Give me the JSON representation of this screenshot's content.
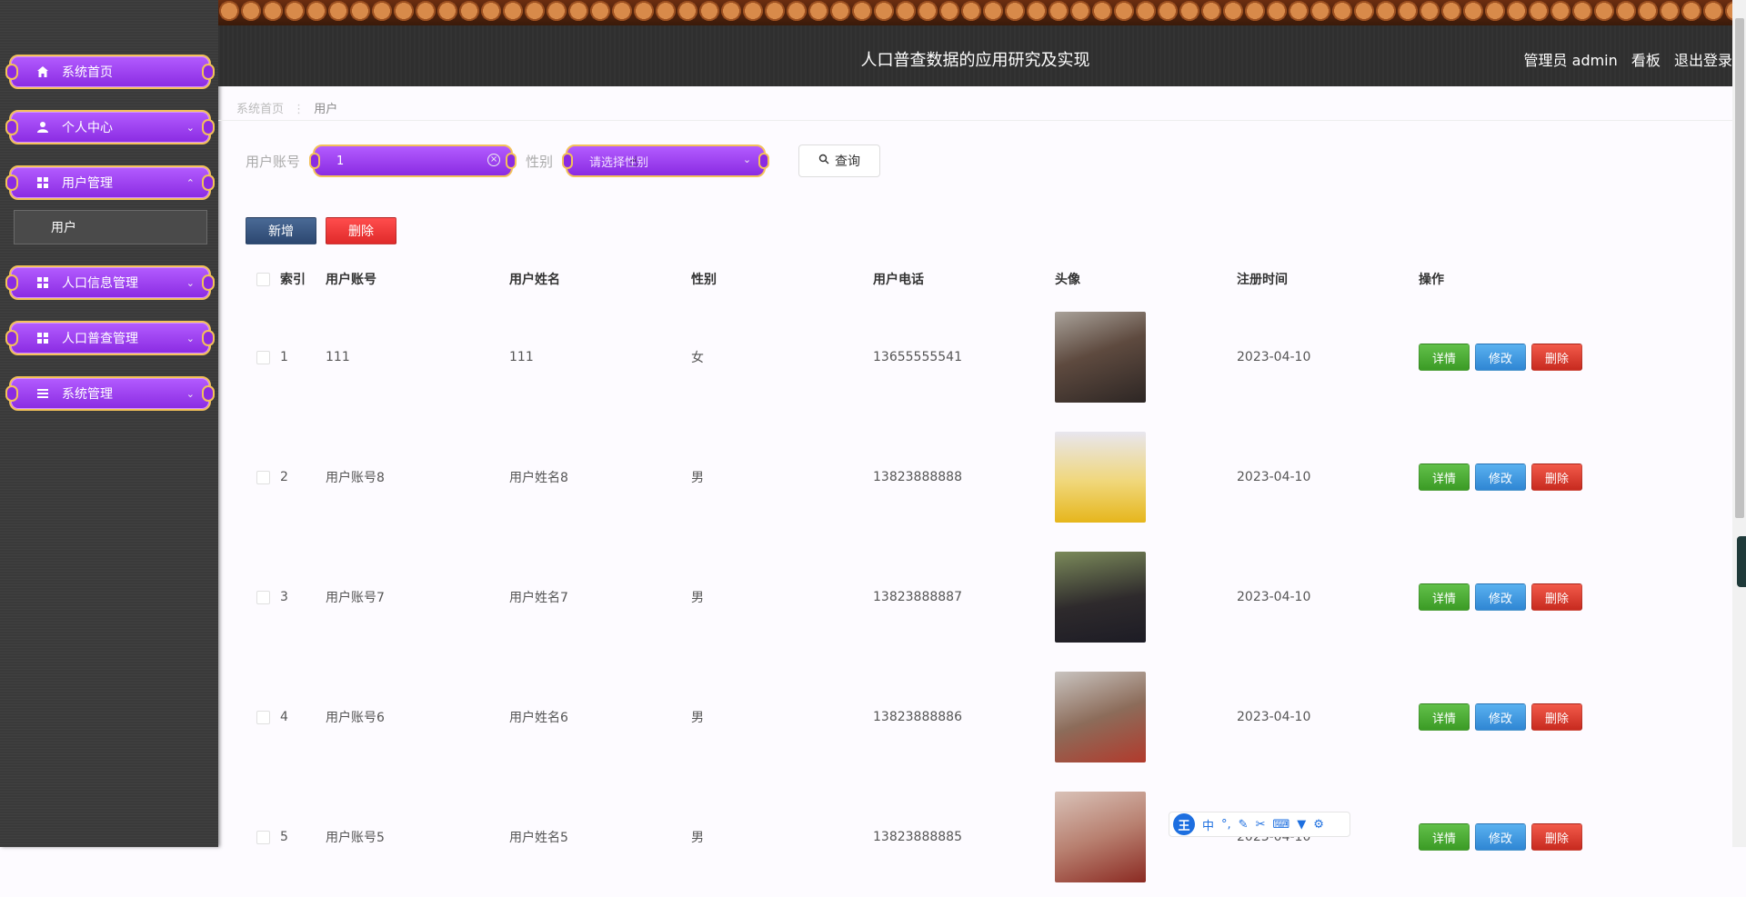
{
  "header": {
    "title": "人口普查数据的应用研究及实现",
    "role_label": "管理员 admin",
    "dashboard_label": "看板",
    "logout_label": "退出登录"
  },
  "sidebar": {
    "items": [
      {
        "label": "系统首页",
        "icon": "home-icon"
      },
      {
        "label": "个人中心",
        "icon": "user-icon"
      },
      {
        "label": "用户管理",
        "icon": "grid-icon"
      },
      {
        "label": "人口信息管理",
        "icon": "grid-icon"
      },
      {
        "label": "人口普查管理",
        "icon": "grid-icon"
      },
      {
        "label": "系统管理",
        "icon": "list-icon"
      }
    ],
    "submenu_active": "用户"
  },
  "breadcrumb": {
    "home": "系统首页",
    "current": "用户"
  },
  "search": {
    "account_label": "用户账号",
    "account_value": "1",
    "gender_label": "性别",
    "gender_placeholder": "请选择性别",
    "search_button": "查询"
  },
  "actions": {
    "add_label": "新增",
    "delete_label": "删除"
  },
  "table": {
    "columns": [
      "索引",
      "用户账号",
      "用户姓名",
      "性别",
      "用户电话",
      "头像",
      "注册时间",
      "操作"
    ],
    "rows": [
      {
        "index": "1",
        "account": "111",
        "name": "111",
        "gender": "女",
        "phone": "13655555541",
        "time": "2023-04-10"
      },
      {
        "index": "2",
        "account": "用户账号8",
        "name": "用户姓名8",
        "gender": "男",
        "phone": "13823888888",
        "time": "2023-04-10"
      },
      {
        "index": "3",
        "account": "用户账号7",
        "name": "用户姓名7",
        "gender": "男",
        "phone": "13823888887",
        "time": "2023-04-10"
      },
      {
        "index": "4",
        "account": "用户账号6",
        "name": "用户姓名6",
        "gender": "男",
        "phone": "13823888886",
        "time": "2023-04-10"
      },
      {
        "index": "5",
        "account": "用户账号5",
        "name": "用户姓名5",
        "gender": "男",
        "phone": "13823888885",
        "time": "2023-04-10"
      }
    ],
    "op_detail": "详情",
    "op_edit": "修改",
    "op_delete": "删除"
  },
  "ime": {
    "logo": "王",
    "mode": "中"
  },
  "colors": {
    "accent_purple": "#9b3ff5",
    "gold_border": "#f3c15a",
    "header_bg": "#2f2f2f",
    "btn_detail": "#3b9b25",
    "btn_edit": "#2f86d4",
    "btn_delete": "#c72a1f"
  }
}
